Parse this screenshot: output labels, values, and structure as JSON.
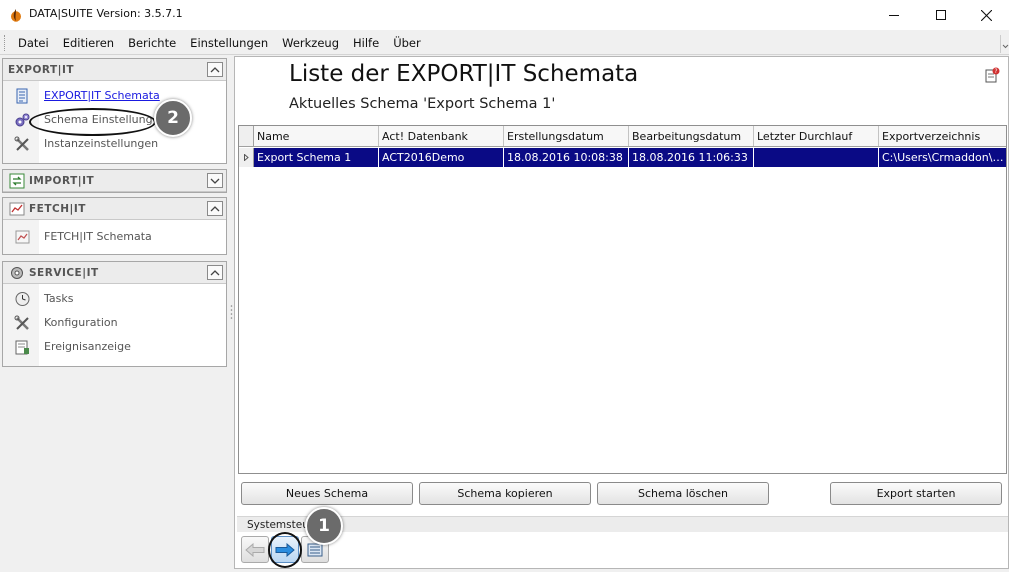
{
  "window": {
    "title": "DATA|SUITE Version: 3.5.7.1"
  },
  "menu": [
    "Datei",
    "Editieren",
    "Berichte",
    "Einstellungen",
    "Werkzeug",
    "Hilfe",
    "Über"
  ],
  "sidebar": {
    "export": {
      "title": "EXPORT|IT",
      "items": [
        "EXPORT|IT Schemata",
        "Schema Einstellungen",
        "Instanzeinstellungen"
      ]
    },
    "import": {
      "title": "IMPORT|IT"
    },
    "fetch": {
      "title": "FETCH|IT",
      "items": [
        "FETCH|IT Schemata"
      ]
    },
    "service": {
      "title": "SERVICE|IT",
      "items": [
        "Tasks",
        "Konfiguration",
        "Ereignisanzeige"
      ]
    }
  },
  "main": {
    "title": "Liste der EXPORT|IT Schemata",
    "subtitle": "Aktuelles Schema 'Export Schema 1'",
    "table": {
      "columns": [
        "Name",
        "Act! Datenbank",
        "Erstellungsdatum",
        "Bearbeitungsdatum",
        "Letzter Durchlauf",
        "Exportverzeichnis"
      ],
      "rows": [
        [
          "Export Schema 1",
          "ACT2016Demo",
          "18.08.2016 10:08:38",
          "18.08.2016 11:06:33",
          "",
          "C:\\Users\\Crmaddon\\D..."
        ]
      ]
    },
    "buttons": {
      "new": "Neues Schema",
      "copy": "Schema kopieren",
      "delete": "Schema löschen",
      "start": "Export starten"
    },
    "system_label": "Systemsteu"
  },
  "annotations": {
    "badge1": "1",
    "badge2": "2"
  }
}
